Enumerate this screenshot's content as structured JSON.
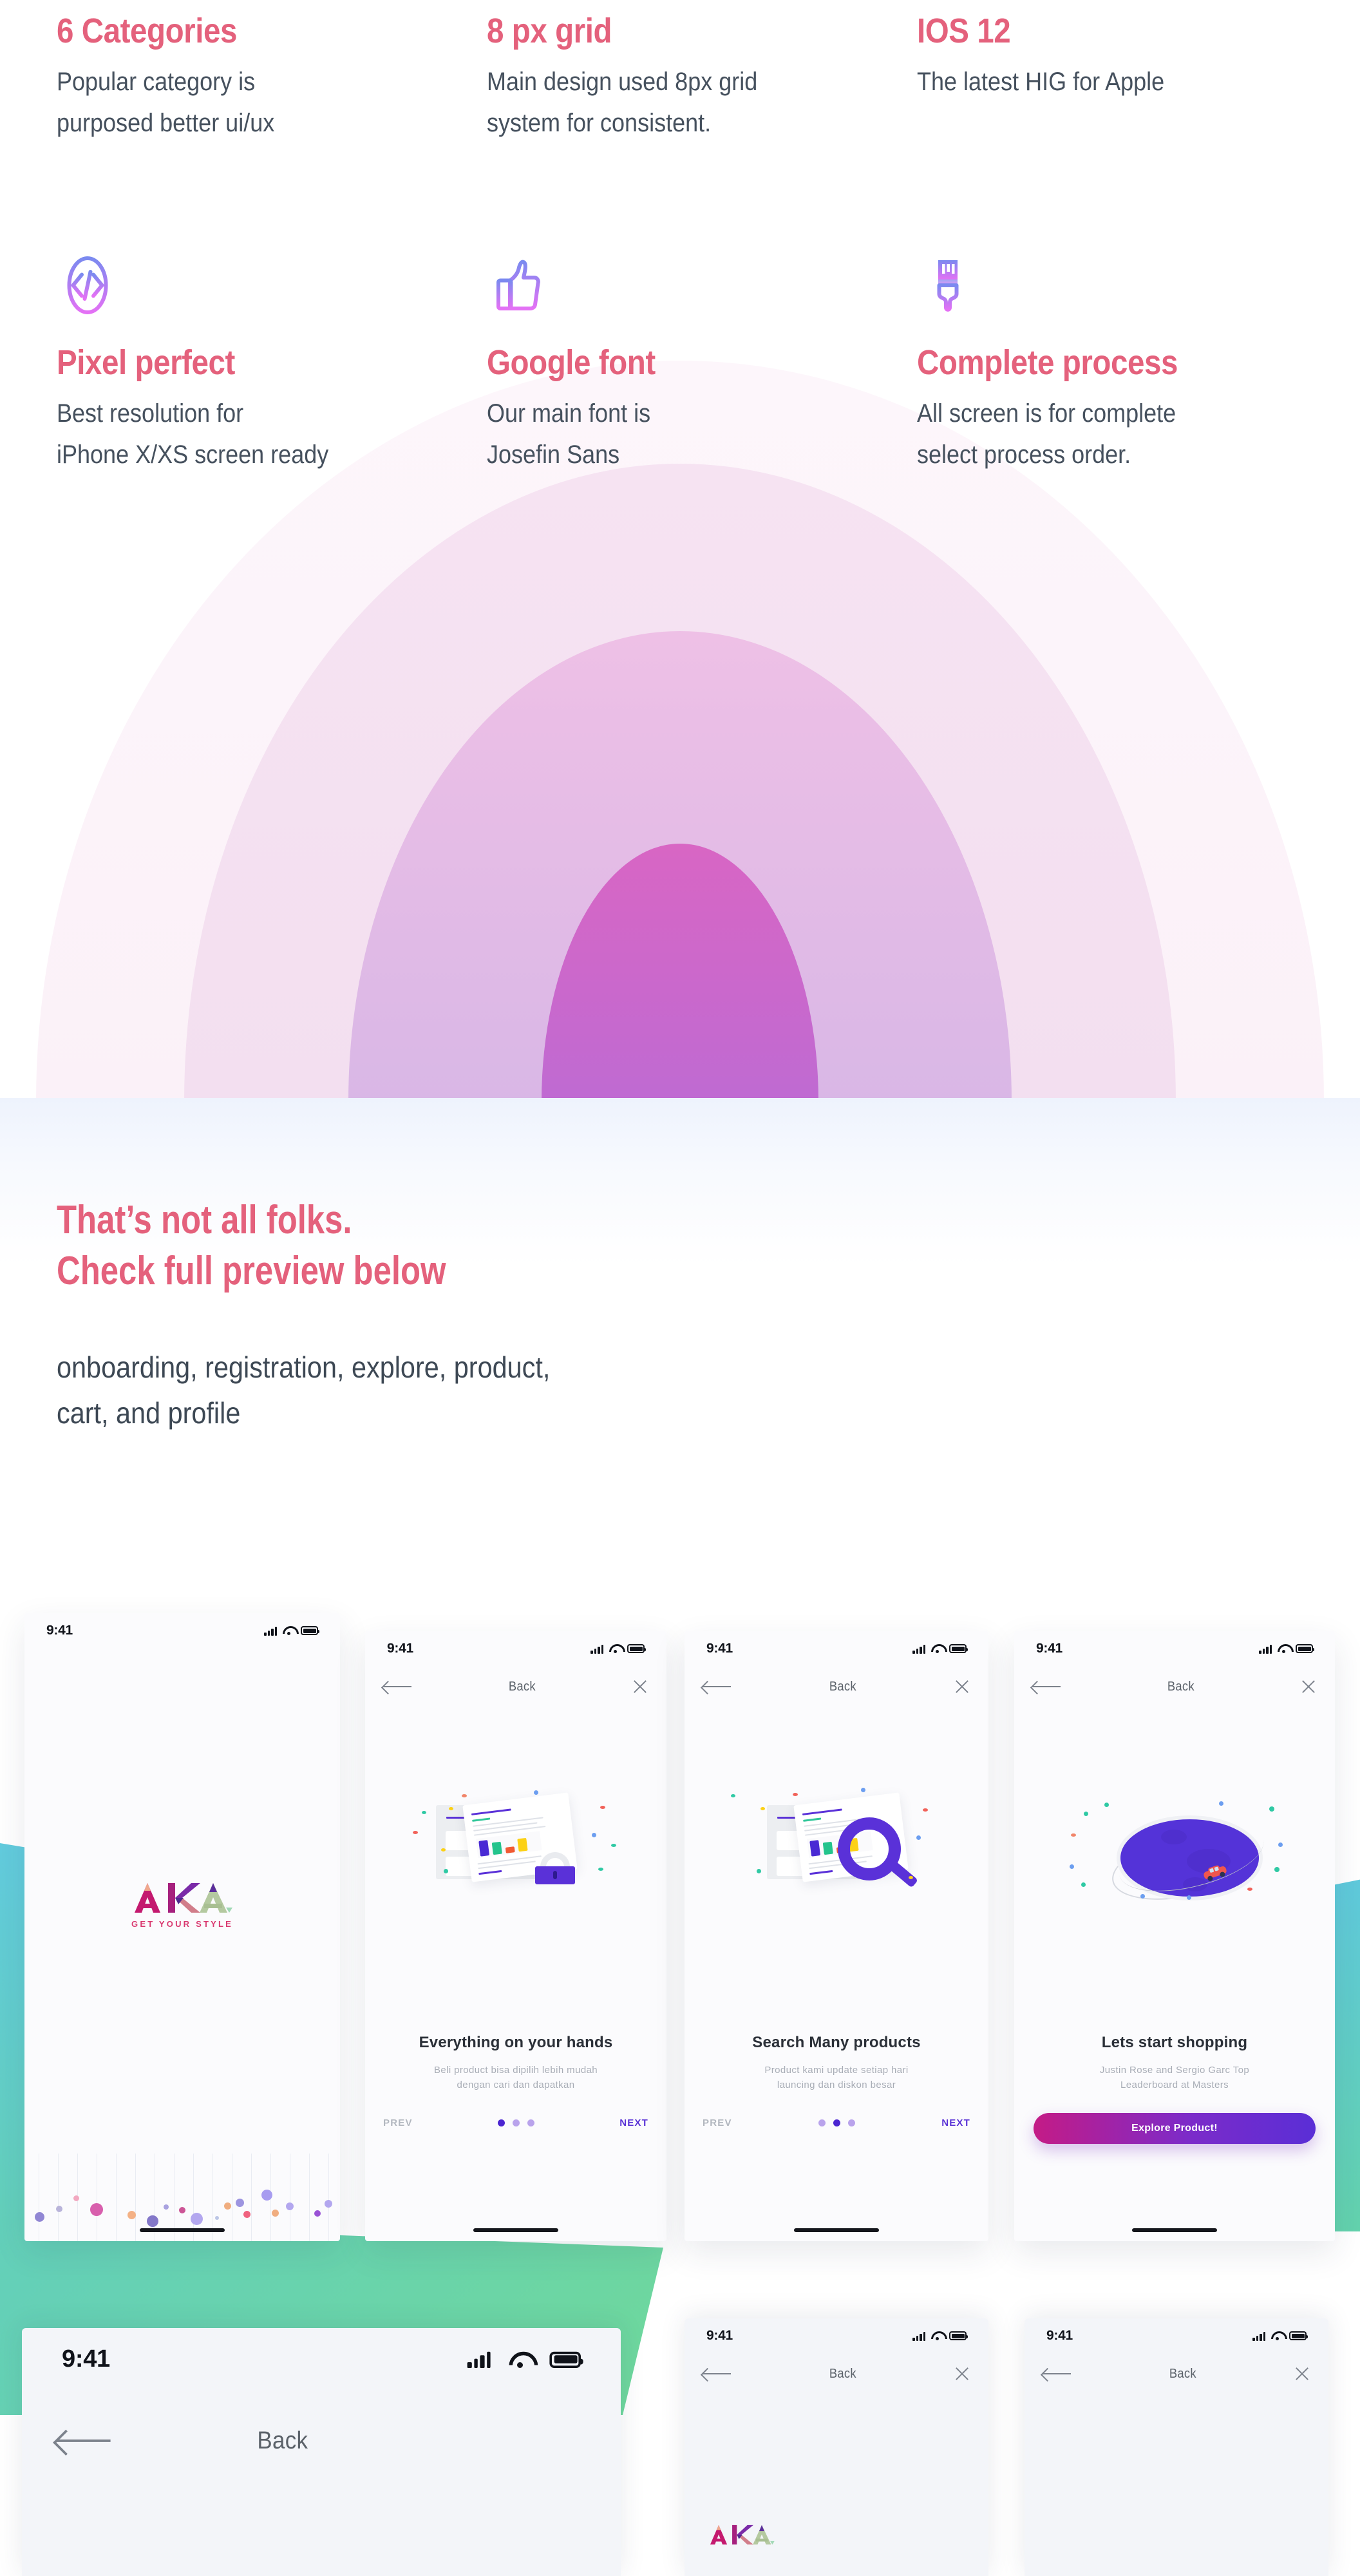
{
  "features": [
    {
      "title": "6 Categories",
      "body": [
        "Popular category is",
        "purposed better ui/ux"
      ],
      "icon": null
    },
    {
      "title": "8 px grid",
      "body": [
        "Main design used 8px grid",
        "system for consistent."
      ],
      "icon": null
    },
    {
      "title": "IOS 12",
      "body": [
        "The latest HIG for Apple"
      ],
      "icon": null
    },
    {
      "title": "Pixel perfect",
      "body": [
        "Best resolution for",
        "iPhone X/XS screen ready"
      ],
      "icon": "code-icon"
    },
    {
      "title": "Google font",
      "body": [
        "Our main font is",
        "Josefin Sans"
      ],
      "icon": "thumbs-up-icon"
    },
    {
      "title": "Complete process",
      "body": [
        "All screen is for complete",
        "select process order."
      ],
      "icon": "paint-brush-icon"
    }
  ],
  "headline": {
    "line1": "That’s not all folks.",
    "line2": "Check full preview below",
    "sub": [
      "onboarding, registration, explore, product,",
      "cart, and profile"
    ]
  },
  "statusbar": {
    "time": "9:41"
  },
  "nav": {
    "back_label": "Back"
  },
  "phones": [
    {
      "kind": "splash",
      "logo": "AKA",
      "logo_sub": "GET YOUR STYLE"
    },
    {
      "kind": "onboarding",
      "title": "Everything on your hands",
      "sub": [
        "Beli product bisa dipilih lebih mudah",
        "dengan cari dan dapatkan"
      ],
      "prev": "PREV",
      "next": "NEXT",
      "active_dot": 0,
      "dot_count": 3,
      "illustration": "document-chart-lock"
    },
    {
      "kind": "onboarding",
      "title": "Search Many products",
      "sub": [
        "Product kami update setiap hari",
        "launcing dan diskon besar"
      ],
      "prev": "PREV",
      "next": "NEXT",
      "active_dot": 1,
      "dot_count": 3,
      "illustration": "document-magnifier"
    },
    {
      "kind": "cta",
      "title": "Lets start shopping",
      "sub": [
        "Justin Rose and Sergio Garc Top",
        "Leaderboard at Masters"
      ],
      "cta": "Explore Product!",
      "illustration": "planet-car"
    }
  ],
  "phones_bottom": [
    {
      "kind": "large",
      "back_label": "Back"
    },
    {
      "kind": "small",
      "back_label": "Back",
      "logo": "AKA"
    },
    {
      "kind": "small",
      "back_label": "Back"
    }
  ],
  "colors": {
    "accent_pink": "#e4617c",
    "body_text": "#46515e",
    "purple": "#5a31d8",
    "teal": "#62cbde",
    "green": "#6fd89b",
    "cta_gradient_from": "#c41b86",
    "cta_gradient_to": "#5a2ed6"
  }
}
